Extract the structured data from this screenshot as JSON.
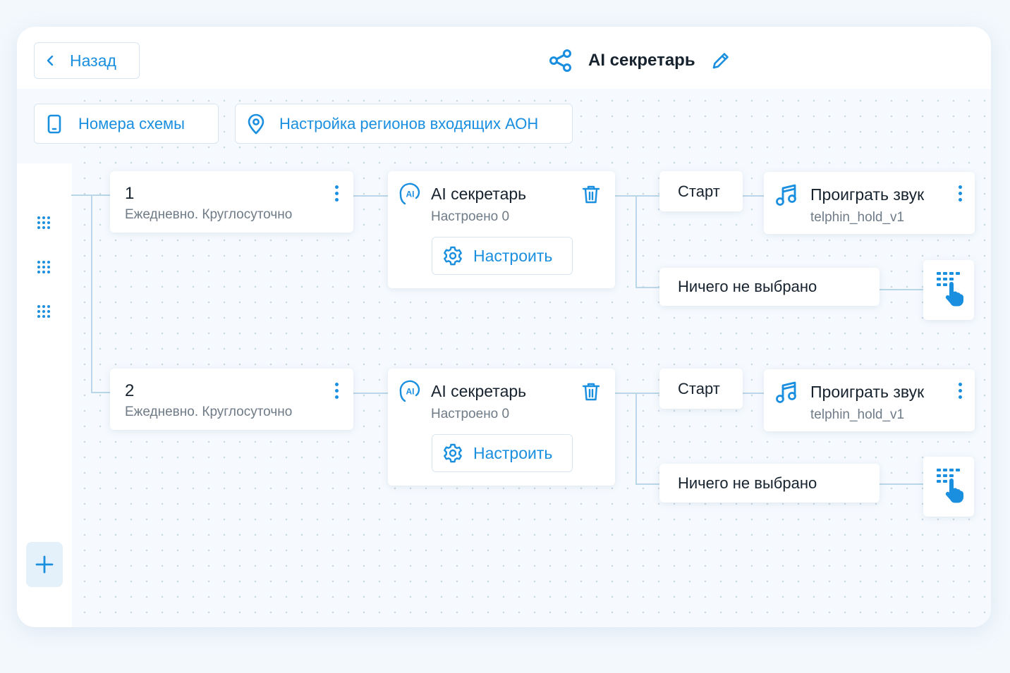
{
  "header": {
    "back_label": "Назад",
    "title": "AI секретарь"
  },
  "toolbar": {
    "numbers_label": "Номера схемы",
    "regions_label": "Настройка регионов входящих АОН"
  },
  "rules": [
    {
      "number": "1",
      "schedule": "Ежедневно. Круглосуточно"
    },
    {
      "number": "2",
      "schedule": "Ежедневно. Круглосуточно"
    }
  ],
  "ai_nodes": [
    {
      "title": "AI секретарь",
      "status": "Настроено 0",
      "button": "Настроить",
      "badge": "AI"
    },
    {
      "title": "AI секретарь",
      "status": "Настроено 0",
      "button": "Настроить",
      "badge": "AI"
    }
  ],
  "branches": [
    {
      "start": "Старт",
      "nothing": "Ничего не выбрано"
    },
    {
      "start": "Старт",
      "nothing": "Ничего не выбрано"
    }
  ],
  "sound_nodes": [
    {
      "title": "Проиграть звук",
      "file": "telphin_hold_v1"
    },
    {
      "title": "Проиграть звук",
      "file": "telphin_hold_v1"
    }
  ],
  "icons": {
    "back": "chevron-left-icon",
    "scheme": "share-nodes-icon",
    "edit": "pencil-icon",
    "phone": "smartphone-icon",
    "location": "map-pin-icon",
    "delete": "trash-icon",
    "settings": "gear-icon",
    "sound": "music-note-icon",
    "keypad": "keypad-tap-icon",
    "add": "plus-icon"
  },
  "colors": {
    "accent": "#1a8fe0",
    "connector": "#b9d7e8",
    "background": "#f6fafe"
  }
}
